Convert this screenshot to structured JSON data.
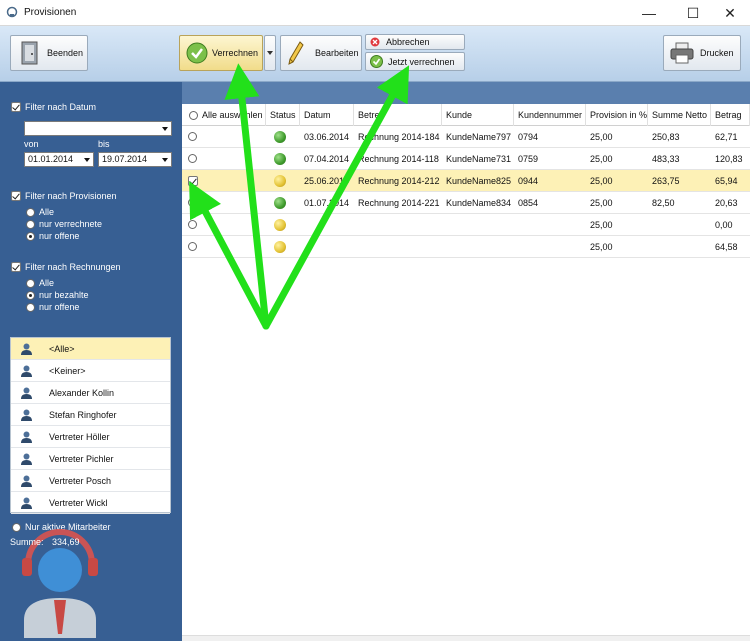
{
  "window": {
    "title": "Provisionen"
  },
  "toolbar": {
    "beenden": "Beenden",
    "verrechnen": "Verrechnen",
    "bearbeiten": "Bearbeiten",
    "abbrechen": "Abbrechen",
    "jetzt": "Jetzt verrechnen",
    "drucken": "Drucken"
  },
  "filters": {
    "datum": {
      "label": "Filter nach Datum",
      "von_label": "von",
      "bis_label": "bis",
      "von": "01.01.2014",
      "bis": "19.07.2014"
    },
    "provisionen": {
      "label": "Filter nach Provisionen",
      "options": [
        "Alle",
        "nur verrechnete",
        "nur offene"
      ],
      "selected": "nur offene"
    },
    "rechnungen": {
      "label": "Filter nach Rechnungen",
      "options": [
        "Alle",
        "nur bezahlte",
        "nur offene"
      ],
      "selected": "nur bezahlte"
    }
  },
  "users": [
    "<Alle>",
    "<Keiner>",
    "Alexander Kollin",
    "Stefan Ringhofer",
    "Vertreter Höller",
    "Vertreter Pichler",
    "Vertreter Posch",
    "Vertreter Wickl"
  ],
  "active_only": "Nur aktive Mitarbeiter",
  "summe": {
    "label": "Summe:",
    "value": "334,69"
  },
  "table": {
    "headers": [
      "Alle auswählen",
      "Status",
      "Datum",
      "Betreff",
      "Kunde",
      "Kundennummer",
      "Provision in %",
      "Summe Netto",
      "Betrag"
    ],
    "rows": [
      {
        "checked": false,
        "status": "green",
        "datum": "03.06.2014",
        "betreff": "Rechnung 2014-184",
        "kunde": "KundeName797",
        "nr": "0794",
        "prov": "25,00",
        "netto": "250,83",
        "betrag": "62,71"
      },
      {
        "checked": false,
        "status": "green",
        "datum": "07.04.2014",
        "betreff": "Rechnung 2014-118",
        "kunde": "KundeName731",
        "nr": "0759",
        "prov": "25,00",
        "netto": "483,33",
        "betrag": "120,83"
      },
      {
        "checked": true,
        "status": "yellow",
        "datum": "25.06.2014",
        "betreff": "Rechnung 2014-212",
        "kunde": "KundeName825",
        "nr": "0944",
        "prov": "25,00",
        "netto": "263,75",
        "betrag": "65,94"
      },
      {
        "checked": false,
        "status": "green",
        "datum": "01.07.2014",
        "betreff": "Rechnung 2014-221",
        "kunde": "KundeName834",
        "nr": "0854",
        "prov": "25,00",
        "netto": "82,50",
        "betrag": "20,63"
      },
      {
        "checked": false,
        "status": "yellow",
        "datum": "",
        "betreff": "",
        "kunde": "",
        "nr": "",
        "prov": "25,00",
        "netto": "",
        "betrag": "0,00"
      },
      {
        "checked": false,
        "status": "yellow",
        "datum": "",
        "betreff": "",
        "kunde": "",
        "nr": "",
        "prov": "25,00",
        "netto": "",
        "betrag": "64,58"
      }
    ]
  },
  "colors": {
    "selected_row": "#fdf1b6",
    "arrow": "#22e01a",
    "sidebar": "#375f93"
  }
}
